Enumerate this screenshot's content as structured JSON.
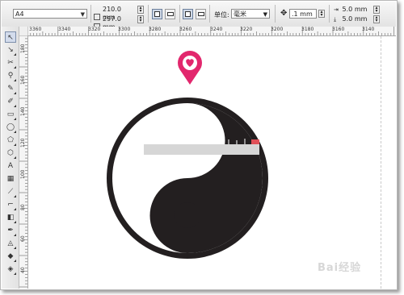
{
  "property_bar": {
    "paper_size": "A4",
    "width": "210.0 mm",
    "height": "297.0 mm",
    "unit_label": "单位:",
    "unit_value": "毫米",
    "nudge": ".1 mm",
    "duplicate_x": "5.0 mm",
    "duplicate_y": "5.0 mm"
  },
  "ruler_top": {
    "ticks": [
      "3360",
      "3340",
      "3320",
      "3300",
      "3280",
      "3260",
      "3240",
      "3220",
      "3200",
      "3180",
      "3160",
      "3140"
    ]
  },
  "ruler_left": {
    "ticks": [
      "180",
      "160",
      "140",
      "120",
      "100",
      "80",
      "60",
      "40"
    ]
  },
  "toolbox": {
    "tools": [
      "pick-tool",
      "shape-tool",
      "crop-tool",
      "zoom-tool",
      "freehand-tool",
      "smart-fill-tool",
      "rectangle-tool",
      "ellipse-tool",
      "polygon-tool",
      "basic-shapes-tool",
      "text-tool",
      "table-tool",
      "parallel-dimension-tool",
      "connector-tool",
      "interactive-blend-tool",
      "eyedropper-tool",
      "outline-pen-tool",
      "fill-tool",
      "interactive-fill-tool"
    ]
  },
  "canvas": {
    "artwork": "yin-yang-symbol",
    "marker_icon": "heart-map-pin-icon"
  },
  "colors": {
    "marker": "#e2276d",
    "symbol_black": "#231f20",
    "toolbar_bg": "#ececec"
  },
  "watermark": "Bai经验"
}
